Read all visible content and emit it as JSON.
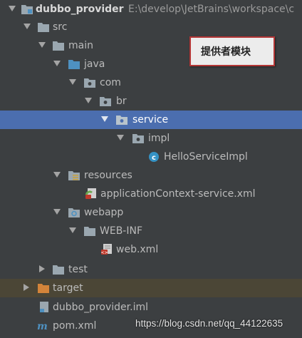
{
  "tree": {
    "root": {
      "name": "dubbo_provider",
      "path": "E:\\develop\\JetBrains\\workspace\\c"
    },
    "src": "src",
    "main": "main",
    "java": "java",
    "com": "com",
    "br": "br",
    "service": "service",
    "impl": "impl",
    "hello_class": "HelloServiceImpl",
    "resources": "resources",
    "app_context": "applicationContext-service.xml",
    "webapp": "webapp",
    "webinf": "WEB-INF",
    "webxml": "web.xml",
    "test": "test",
    "target": "target",
    "iml": "dubbo_provider.iml",
    "pom": "pom.xml"
  },
  "callout": {
    "text": "提供者模块"
  },
  "watermark": "https://blog.csdn.net/qq_44122635",
  "colors": {
    "background": "#3c3f41",
    "selection": "#4b6eaf",
    "excluded": "#4b4636",
    "folder": "#9aa7b0",
    "source_folder": "#4e91c1",
    "target_folder": "#d3843a",
    "callout_border": "#b33636"
  },
  "icons": {
    "root": "module-folder-icon",
    "folder": "folder-icon",
    "package": "package-icon",
    "class": "class-icon",
    "xml_spring": "spring-xml-icon",
    "iml": "iml-file-icon",
    "maven": "maven-icon"
  }
}
